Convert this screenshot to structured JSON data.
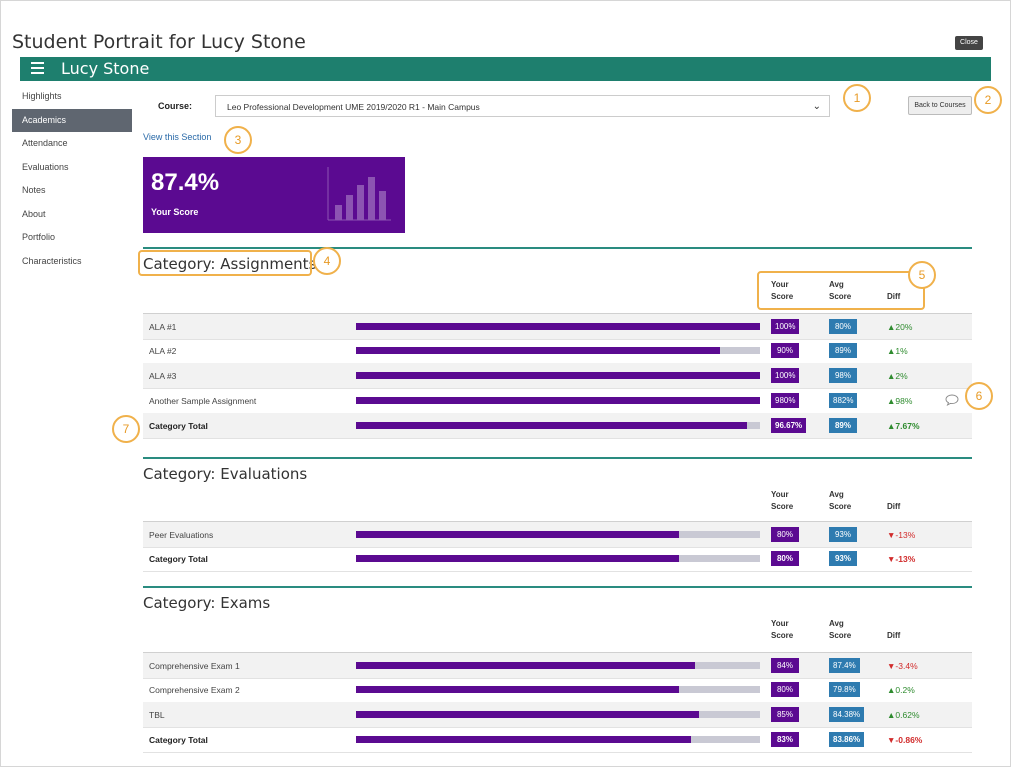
{
  "page": {
    "title": "Student Portrait for Lucy Stone",
    "close_label": "Close"
  },
  "header": {
    "student_name": "Lucy Stone"
  },
  "sidebar": {
    "items": [
      {
        "label": "Highlights"
      },
      {
        "label": "Academics",
        "active": true
      },
      {
        "label": "Attendance"
      },
      {
        "label": "Evaluations"
      },
      {
        "label": "Notes"
      },
      {
        "label": "About"
      },
      {
        "label": "Portfolio"
      },
      {
        "label": "Characteristics"
      }
    ]
  },
  "course": {
    "label": "Course:",
    "selected": "Leo Professional Development UME 2019/2020 R1 - Main Campus",
    "back_label": "Back to Courses",
    "view_link": "View this Section"
  },
  "score_card": {
    "value": "87.4%",
    "caption": "Your Score"
  },
  "columns": {
    "your_1": "Your",
    "your_2": "Score",
    "avg_1": "Avg",
    "avg_2": "Score",
    "diff": "Diff"
  },
  "callouts": [
    "1",
    "2",
    "3",
    "4",
    "5",
    "6",
    "7"
  ],
  "categories": [
    {
      "title": "Category: Assignments",
      "rows": [
        {
          "label": "ALA #1",
          "your": "100%",
          "avg": "80%",
          "diff": "20%",
          "dir": "up",
          "fill": 1.0
        },
        {
          "label": "ALA #2",
          "your": "90%",
          "avg": "89%",
          "diff": "1%",
          "dir": "up",
          "fill": 0.9
        },
        {
          "label": "ALA #3",
          "your": "100%",
          "avg": "98%",
          "diff": "2%",
          "dir": "up",
          "fill": 1.0
        },
        {
          "label": "Another Sample Assignment",
          "your": "980%",
          "avg": "882%",
          "diff": "98%",
          "dir": "up",
          "fill": 1.0,
          "comment": true
        }
      ],
      "total": {
        "label": "Category Total",
        "your": "96.67%",
        "avg": "89%",
        "diff": "7.67%",
        "dir": "up",
        "fill": 0.9667
      }
    },
    {
      "title": "Category: Evaluations",
      "rows": [
        {
          "label": "Peer Evaluations",
          "your": "80%",
          "avg": "93%",
          "diff": "-13%",
          "dir": "down",
          "fill": 0.8
        }
      ],
      "total": {
        "label": "Category Total",
        "your": "80%",
        "avg": "93%",
        "diff": "-13%",
        "dir": "down",
        "fill": 0.8
      }
    },
    {
      "title": "Category: Exams",
      "rows": [
        {
          "label": "Comprehensive Exam 1",
          "your": "84%",
          "avg": "87.4%",
          "diff": "-3.4%",
          "dir": "down",
          "fill": 0.84
        },
        {
          "label": "Comprehensive Exam 2",
          "your": "80%",
          "avg": "79.8%",
          "diff": "0.2%",
          "dir": "up",
          "fill": 0.8
        },
        {
          "label": "TBL",
          "your": "85%",
          "avg": "84.38%",
          "diff": "0.62%",
          "dir": "up",
          "fill": 0.85
        }
      ],
      "total": {
        "label": "Category Total",
        "your": "83%",
        "avg": "83.86%",
        "diff": "-0.86%",
        "dir": "down",
        "fill": 0.83
      }
    }
  ],
  "colors": {
    "brand": "#1e7f6e",
    "your_score": "#5b0a91",
    "avg_score": "#2e7bb0",
    "up": "#2e8b2e",
    "down": "#d12b2b",
    "callout": "#f0b14b"
  }
}
